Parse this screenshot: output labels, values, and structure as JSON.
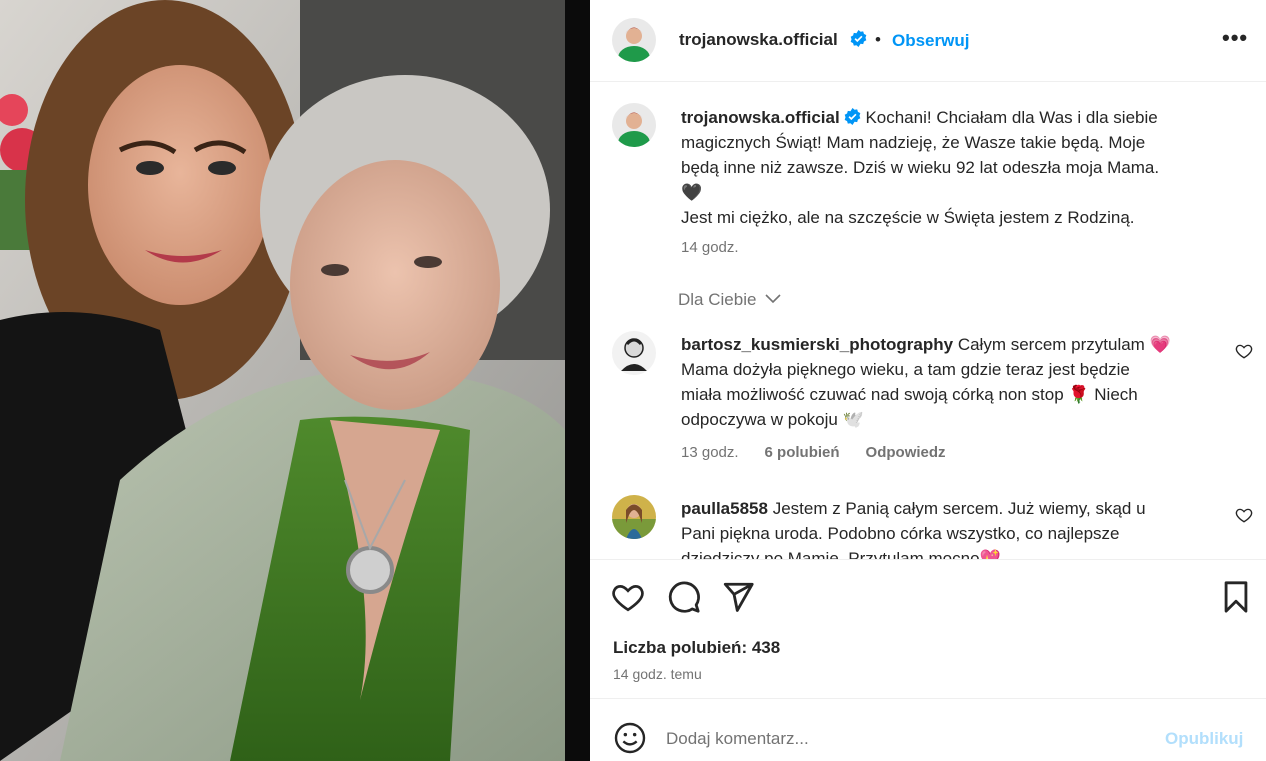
{
  "post": {
    "author": "trojanowska.official",
    "follow_label": "Obserwuj",
    "more_label": "•••",
    "dot": "•"
  },
  "caption": {
    "username": "trojanowska.official",
    "lines": [
      "Kochani! Chciałam dla Was i dla siebie",
      "magicznych Świąt! Mam nadzieję, że Wasze takie będą. Moje",
      "będą inne niż zawsze. Dziś w wieku 92 lat odeszła moja Mama.",
      "🖤",
      "Jest mi ciężko, ale na szczęście w Święta jestem z Rodziną."
    ],
    "time": "14 godz."
  },
  "for_you_label": "Dla Ciebie",
  "comments": [
    {
      "username": "bartosz_kusmierski_photography",
      "lines": [
        "Całym sercem przytulam 💗",
        "Mama dożyła pięknego wieku, a tam gdzie teraz jest będzie",
        "miała możliwość czuwać nad swoją córką non stop 🌹  Niech",
        "odpoczywa w pokoju 🕊️"
      ],
      "time": "13 godz.",
      "likes": "6 polubień",
      "reply": "Odpowiedz"
    },
    {
      "username": "paulla5858",
      "lines": [
        "Jestem z Panią całym sercem. Już wiemy, skąd u",
        "Pani piękna uroda. Podobno córka wszystko, co najlepsze",
        "dziedziczy po Mamie. Przytulam mocno💖"
      ]
    }
  ],
  "stats": {
    "likes_label": "Liczba polubień: 438",
    "time_ago": "14 godz. temu"
  },
  "composer": {
    "placeholder": "Dodaj komentarz...",
    "publish": "Opublikuj"
  },
  "colors": {
    "accent": "#0095f6",
    "publish_disabled": "#b2dffc",
    "muted": "#737373",
    "text": "#262626"
  },
  "icons": [
    "verified-badge-icon",
    "heart-icon",
    "comment-icon",
    "share-icon",
    "bookmark-icon",
    "smile-icon",
    "chevron-down-icon"
  ]
}
